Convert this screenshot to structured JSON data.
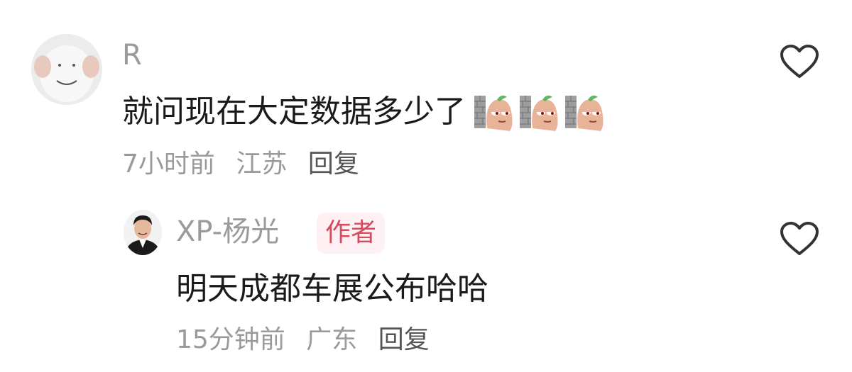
{
  "comments": [
    {
      "author": "R",
      "text": "就问现在大定数据多少了",
      "stickers": [
        "sweet-potato-smirk-emoji",
        "sweet-potato-smirk-emoji",
        "sweet-potato-smirk-emoji"
      ],
      "time": "7小时前",
      "location": "江苏",
      "reply_label": "回复",
      "like_icon": "heart-outline-icon"
    },
    {
      "author": "XP-杨光",
      "badge": "作者",
      "text": "明天成都车展公布哈哈",
      "time": "15分钟前",
      "location": "广东",
      "reply_label": "回复",
      "like_icon": "heart-outline-icon"
    }
  ],
  "colors": {
    "username": "#9a9a9a",
    "body_text": "#1a1a1a",
    "reply": "#555555",
    "author_badge_text": "#d84a5e",
    "author_badge_bg": "#fff1f3",
    "heart_outline": "#333333"
  }
}
